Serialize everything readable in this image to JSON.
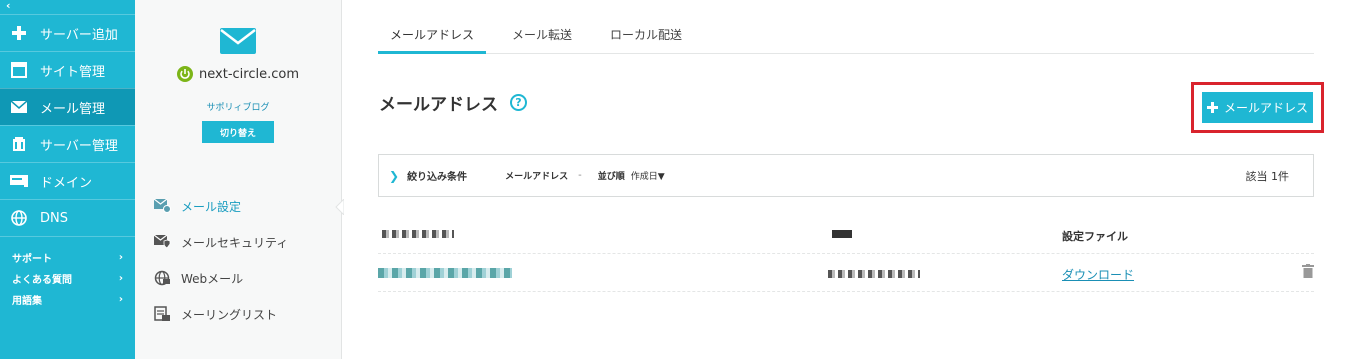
{
  "nav": {
    "collapse_label": "‹",
    "items": [
      {
        "label": "サーバー追加",
        "icon": "plus-icon"
      },
      {
        "label": "サイト管理",
        "icon": "window-icon"
      },
      {
        "label": "メール管理",
        "icon": "mail-icon"
      },
      {
        "label": "サーバー管理",
        "icon": "server-icon"
      },
      {
        "label": "ドメイン",
        "icon": "domain-icon"
      },
      {
        "label": "DNS",
        "icon": "globe-icon"
      }
    ],
    "links": [
      "サポート",
      "よくある質問",
      "用語集"
    ],
    "link_arrow": "›"
  },
  "server_panel": {
    "domain": "next-circle.com",
    "blog_name": "サポリィブログ",
    "switch_label": "切り替え",
    "menu": [
      {
        "label": "メール設定",
        "icon": "mail-settings-icon"
      },
      {
        "label": "メールセキュリティ",
        "icon": "mail-security-icon"
      },
      {
        "label": "Webメール",
        "icon": "webmail-icon"
      },
      {
        "label": "メーリングリスト",
        "icon": "mailing-list-icon"
      }
    ]
  },
  "tabs": [
    "メールアドレス",
    "メール転送",
    "ローカル配送"
  ],
  "page_title": "メールアドレス",
  "help_label": "?",
  "add_button_label": "メールアドレス",
  "filter": {
    "chevron": "❯",
    "label": "絞り込み条件",
    "mail_label": "メールアドレス",
    "mail_value": "-",
    "sort_label": "並び順",
    "sort_value": "作成日▼",
    "count": "該当 1件"
  },
  "table": {
    "config_header": "設定ファイル",
    "download_label": "ダウンロード"
  },
  "colors": {
    "accent": "#1fb7d3",
    "accent_dark": "#0f98b5",
    "highlight": "#d9232d",
    "link": "#1a8fb5"
  }
}
